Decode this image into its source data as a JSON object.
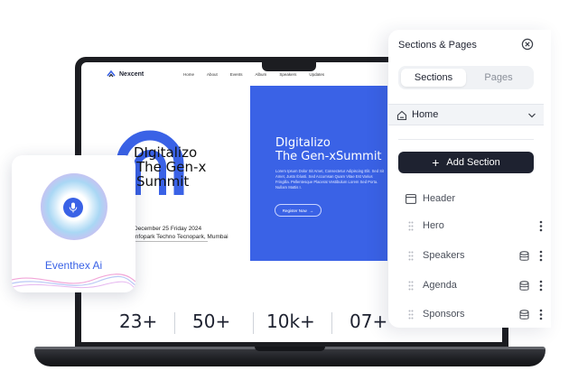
{
  "site": {
    "brand": "Nexcent",
    "nav": [
      "Home",
      "About",
      "Events",
      "Album",
      "Speakers",
      "Updates"
    ],
    "hero_title_line1": "DIgitalizo",
    "hero_title_line2": "The Gen-x",
    "hero_title_line3": "Summit",
    "hero_date_line1": "December 25 Friday 2024",
    "hero_date_line2": "Infopark Techno Tecnopark, Mumbai",
    "blue_title_line1": "DIgitalizo",
    "blue_title_line2": "The Gen-xSummit",
    "blue_body": "Lorem Ipsum Dolor Sit Amet, Consectetur Adipiscing Elit. Sed Sit Amet, Justo Iblusti. Sed Accumsan Quam Vitae Est Varius Fringilla. Pellentesque Placerat Vestibulum Lorem Sed Porta. Nullam Mattis I.",
    "register_label": "Register Now",
    "stats": [
      "23+",
      "50+",
      "10k+",
      "07+"
    ],
    "accent": "#3a62e6"
  },
  "ai_card": {
    "label": "Eventhex Ai",
    "icon": "microphone-icon"
  },
  "panel": {
    "title": "Sections & Pages",
    "tabs": [
      "Sections",
      "Pages"
    ],
    "active_tab": "Sections",
    "page_selected": "Home",
    "add_section_label": "Add Section",
    "header_label": "Header",
    "sections": [
      {
        "label": "Hero",
        "has_data": false
      },
      {
        "label": "Speakers",
        "has_data": true
      },
      {
        "label": "Agenda",
        "has_data": true
      },
      {
        "label": "Sponsors",
        "has_data": true
      }
    ]
  }
}
